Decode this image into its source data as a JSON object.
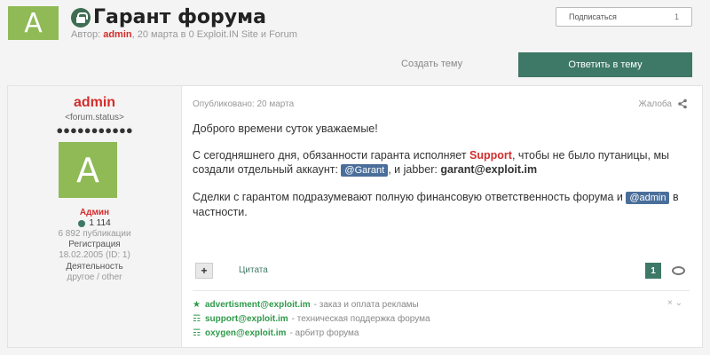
{
  "topic": {
    "avatar_letter": "A",
    "title": "Гарант форума",
    "meta_prefix": "Автор:",
    "author": "admin",
    "meta_suffix": ", 20 марта в 0 Exploit.IN Site и Forum"
  },
  "subscribe": {
    "label": "Подписаться",
    "count": "1"
  },
  "actions": {
    "create_topic": "Создать тему",
    "reply": "Ответить в тему"
  },
  "post": {
    "author": {
      "name": "admin",
      "status": "<forum.status>",
      "stars": "●●●●●●●●●●●",
      "avatar_letter": "A",
      "group": "Админ",
      "reputation": "1 114",
      "posts": "6 892 публикации",
      "reg_label": "Регистрация",
      "reg_value": "18.02.2005 (ID: 1)",
      "activity_label": "Деятельность",
      "activity_value": "другое / other"
    },
    "published": "Опубликовано: 20 марта",
    "report": "Жалоба",
    "body": {
      "greeting": "Доброго времени суток уважаемые!",
      "p2_a": "С сегодняшнего дня, обязанности гаранта исполняет ",
      "p2_support": "Support",
      "p2_b": ", чтобы не было путаницы, мы создали отдельный аккаунт: ",
      "p2_mention": "@Garant",
      "p2_c": ", и jabber: ",
      "p2_jabber": "garant@exploit.im",
      "p3_a": "Сделки с гарантом подразумевают полную финансовую ответственность форума и ",
      "p3_mention": "@admin",
      "p3_b": " в частности."
    },
    "quote_label": "Цитата",
    "like_count": "1",
    "signature": [
      {
        "icon": "★",
        "email": "advertisment@exploit.im",
        "desc": "- заказ и оплата рекламы"
      },
      {
        "icon": "☶",
        "email": "support@exploit.im",
        "desc": "- техническая поддержка форума"
      },
      {
        "icon": "☶",
        "email": "oxygen@exploit.im",
        "desc": "- арбитр форума"
      }
    ],
    "sig_close": "× ⌄"
  }
}
